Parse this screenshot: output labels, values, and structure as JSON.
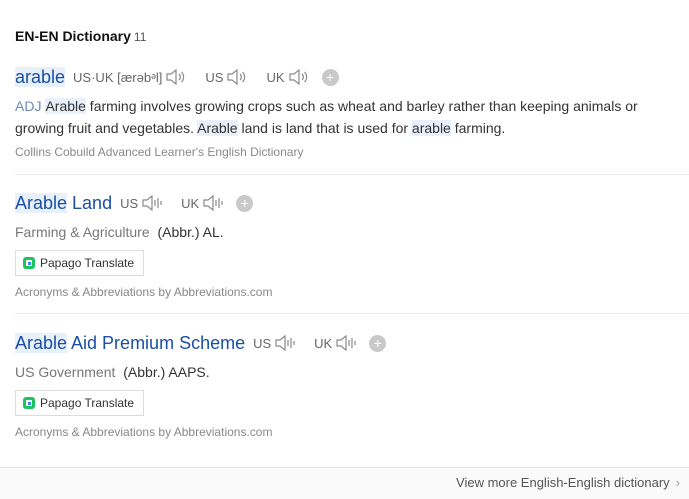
{
  "header": {
    "title": "EN-EN Dictionary",
    "count": "11"
  },
  "entries": [
    {
      "headword_hl": "arable",
      "headword_rest": "",
      "pron_label": "US·UK [ærəbᵊl]",
      "us_label": "US",
      "uk_label": "UK",
      "pos": "ADJ",
      "def_parts": [
        {
          "t": "Arable",
          "hl": true
        },
        {
          "t": " farming involves growing crops such as wheat and barley rather than keeping animals or growing fruit and vegetables. ",
          "hl": false
        },
        {
          "t": "Arable",
          "hl": true
        },
        {
          "t": " land is land that is used for ",
          "hl": false
        },
        {
          "t": "arable",
          "hl": true
        },
        {
          "t": " farming.",
          "hl": false
        }
      ],
      "source": "Collins Cobuild Advanced Learner's English Dictionary"
    },
    {
      "headword_hl": "Arable",
      "headword_rest": " Land",
      "us_label": "US",
      "uk_label": "UK",
      "category": "Farming & Agriculture",
      "abbr": "(Abbr.) AL.",
      "translate_label": "Papago Translate",
      "source": "Acronyms & Abbreviations by Abbreviations.com"
    },
    {
      "headword_hl": "Arable",
      "headword_rest": " Aid Premium Scheme",
      "us_label": "US",
      "uk_label": "UK",
      "category": "US Government",
      "abbr": "(Abbr.) AAPS.",
      "translate_label": "Papago Translate",
      "source": "Acronyms & Abbreviations by Abbreviations.com"
    }
  ],
  "footer": {
    "more_label": "View more English-English dictionary"
  },
  "icons": {
    "speaker_wave": "speaker-wave-icon",
    "speaker_bars": "speaker-bars-icon",
    "plus": "plus-icon",
    "papago": "papago-logo-icon",
    "chevron": "chevron-right-icon"
  },
  "colors": {
    "headword": "#1a4fa5",
    "highlight": "#e8f0fb",
    "pos": "#6b8bb7",
    "papago_green": "#1ec25e",
    "papago_blue": "#2d8cf0"
  }
}
